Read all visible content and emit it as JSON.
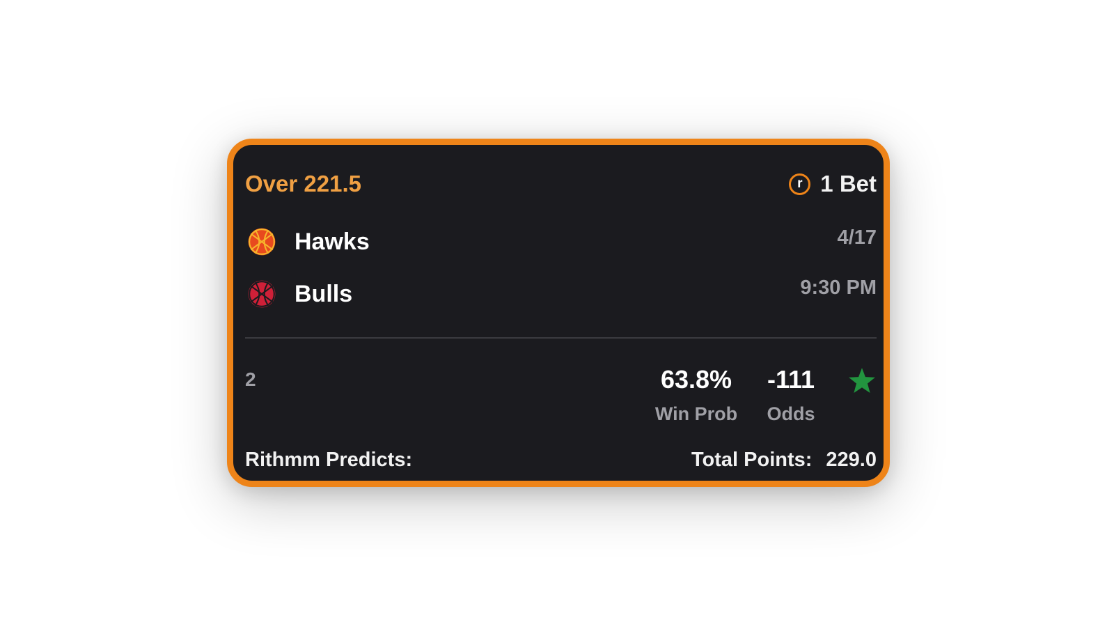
{
  "card": {
    "bet_title": "Over 221.5",
    "bet_count": "1 Bet",
    "brand_icon_letter": "r",
    "teams": [
      {
        "name": "Hawks",
        "icon": "basketball-icon",
        "icon_color": "#e84a1e"
      },
      {
        "name": "Bulls",
        "icon": "basketball-icon",
        "icon_color": "#cf2038"
      }
    ],
    "game_date": "4/17",
    "game_time": "9:30 PM",
    "rank": "2",
    "win_prob": {
      "value": "63.8%",
      "label": "Win Prob"
    },
    "odds": {
      "value": "-111",
      "label": "Odds"
    },
    "favorite_icon": "star-icon",
    "predicts_label": "Rithmm Predicts:",
    "predicts_metric_label": "Total Points:",
    "predicts_metric_value": "229.0"
  },
  "colors": {
    "accent": "#ee8419",
    "title": "#f0a043",
    "background": "#1b1b1f",
    "muted_text": "#a0a0a6",
    "star": "#22943f"
  }
}
